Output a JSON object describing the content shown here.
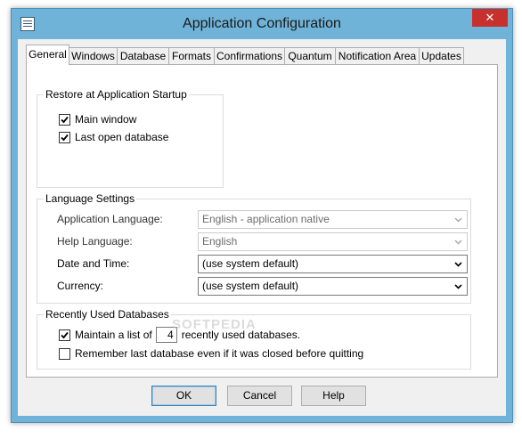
{
  "window": {
    "title": "Application Configuration",
    "close_glyph": "✕"
  },
  "tabs": [
    {
      "label": "General",
      "active": true
    },
    {
      "label": "Windows"
    },
    {
      "label": "Database"
    },
    {
      "label": "Formats"
    },
    {
      "label": "Confirmations"
    },
    {
      "label": "Quantum"
    },
    {
      "label": "Notification Area"
    },
    {
      "label": "Updates"
    }
  ],
  "restore": {
    "title": "Restore at Application Startup",
    "main_window": {
      "label": "Main window",
      "checked": true
    },
    "last_open_db": {
      "label": "Last open database",
      "checked": true
    }
  },
  "language": {
    "title": "Language Settings",
    "app_language": {
      "label": "Application Language:",
      "value": "English - application native",
      "enabled": false
    },
    "help_language": {
      "label": "Help Language:",
      "value": "English",
      "enabled": false
    },
    "date_time": {
      "label": "Date and Time:",
      "value": "(use system default)",
      "enabled": true
    },
    "currency": {
      "label": "Currency:",
      "value": "(use system default)",
      "enabled": true
    }
  },
  "recent": {
    "title": "Recently Used Databases",
    "maintain_prefix": "Maintain a list of",
    "maintain_count": "4",
    "maintain_suffix": "recently used databases.",
    "maintain_checked": true,
    "remember_label": "Remember last database even if it was closed before quitting",
    "remember_checked": false
  },
  "watermark": "SOFTPEDIA",
  "buttons": {
    "ok": "OK",
    "cancel": "Cancel",
    "help": "Help"
  }
}
